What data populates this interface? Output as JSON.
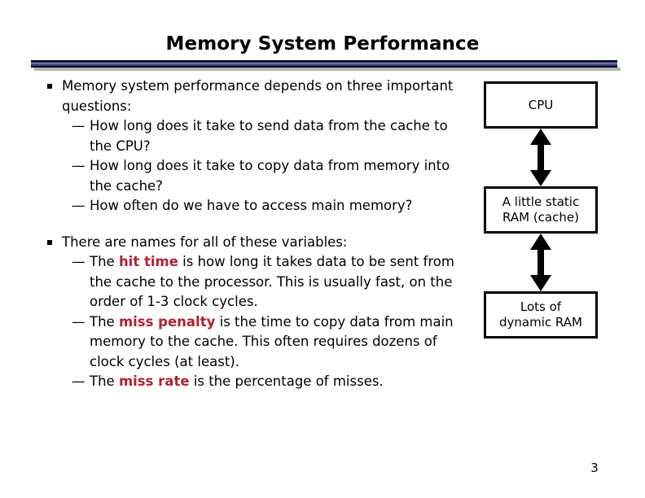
{
  "slide": {
    "title": "Memory System Performance",
    "page_number": "3",
    "accent_color": "#AF2233",
    "rule_color": "#3b3b8f"
  },
  "content": {
    "block1": {
      "bullet": "Memory system performance depends on three important questions:",
      "sub": [
        "How long does it take to send data from the cache to the CPU?",
        "How long does it take to copy data from memory into the cache?",
        "How often do we have to access main memory?"
      ]
    },
    "block2": {
      "bullet": "There are names for all of these variables:",
      "sub": [
        {
          "pre": "The ",
          "keyword": "hit time",
          "post": " is how long it takes data to be sent from the cache to the processor. This is usually fast, on the order of 1-3 clock cycles."
        },
        {
          "pre": "The ",
          "keyword": "miss penalty",
          "post": " is the time to copy data from main memory to the cache. This often requires dozens of clock cycles (at least)."
        },
        {
          "pre": "The ",
          "keyword": "miss rate",
          "post": " is the percentage of misses."
        }
      ]
    }
  },
  "diagram": {
    "boxes": [
      {
        "label": "CPU"
      },
      {
        "label": "A little static\nRAM (cache)"
      },
      {
        "label": "Lots of\ndynamic RAM"
      }
    ],
    "arrows": [
      {
        "name": "cpu-cache-arrow",
        "direction": "double-vertical"
      },
      {
        "name": "cache-dram-arrow",
        "direction": "double-vertical"
      }
    ]
  }
}
